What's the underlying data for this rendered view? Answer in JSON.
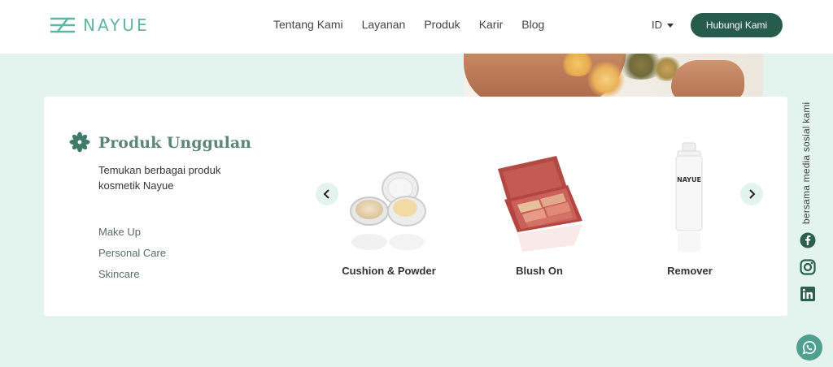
{
  "header": {
    "logo_text": "NAYUE",
    "nav": [
      "Tentang Kami",
      "Layanan",
      "Produk",
      "Karir",
      "Blog"
    ],
    "lang": "ID",
    "cta": "Hubungi Kami"
  },
  "section": {
    "title": "Produk Unggulan",
    "description": "Temukan berbagai produk kosmetik Nayue",
    "categories": [
      "Make Up",
      "Personal Care",
      "Skincare"
    ]
  },
  "products": [
    {
      "name": "Cushion & Powder",
      "image": "cushion-powder-image"
    },
    {
      "name": "Blush On",
      "image": "blush-palette-image"
    },
    {
      "name": "Remover",
      "image": "remover-bottle-image",
      "bottle_label": "NAYUE"
    }
  ],
  "social": {
    "caption": "bersama media sosial kami",
    "icons": [
      "facebook-icon",
      "instagram-icon",
      "linkedin-icon"
    ],
    "whatsapp": "whatsapp-icon"
  },
  "colors": {
    "brand_dark": "#275c4d",
    "brand_teal": "#5fb4a3",
    "page_bg": "#e3f4ef",
    "title": "#5c8578"
  }
}
